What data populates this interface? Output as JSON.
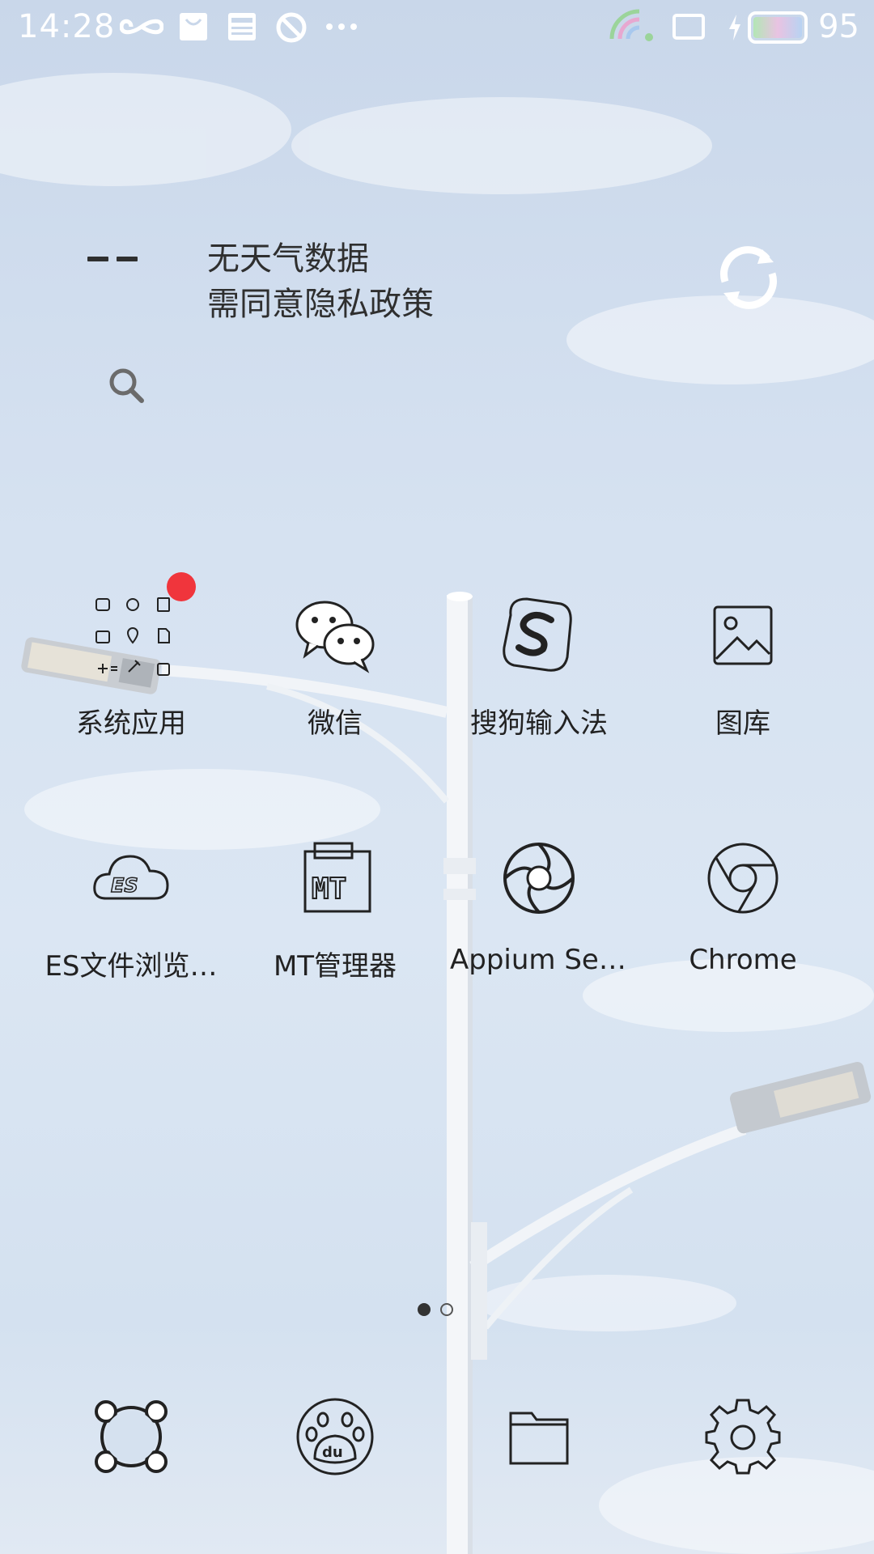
{
  "status_bar": {
    "time": "14:28",
    "battery": "95",
    "icons": [
      "infinity-icon",
      "bag-icon",
      "news-icon",
      "blocked-icon",
      "more-dots-icon",
      "wifi-icon",
      "tablet-icon",
      "charging-icon",
      "battery-icon"
    ]
  },
  "weather": {
    "temp": "--",
    "line1": "无天气数据",
    "line2": "需同意隐私政策"
  },
  "apps": [
    {
      "label": "系统应用",
      "icon": "folder-system-apps-icon"
    },
    {
      "label": "微信",
      "icon": "wechat-icon"
    },
    {
      "label": "搜狗输入法",
      "icon": "sogou-icon"
    },
    {
      "label": "图库",
      "icon": "gallery-icon"
    },
    {
      "label": "ES文件浏览…",
      "icon": "es-file-icon"
    },
    {
      "label": "MT管理器",
      "icon": "mt-manager-icon"
    },
    {
      "label": "Appium Set…",
      "icon": "appium-icon"
    },
    {
      "label": "Chrome",
      "icon": "chrome-icon"
    }
  ],
  "pages": {
    "count": 2,
    "current": 1
  },
  "dock": [
    "phone-icon",
    "baidu-icon",
    "files-icon",
    "settings-icon"
  ],
  "colors": {
    "badge": "#f0353c",
    "text": "#222222",
    "status": "#ffffff"
  }
}
